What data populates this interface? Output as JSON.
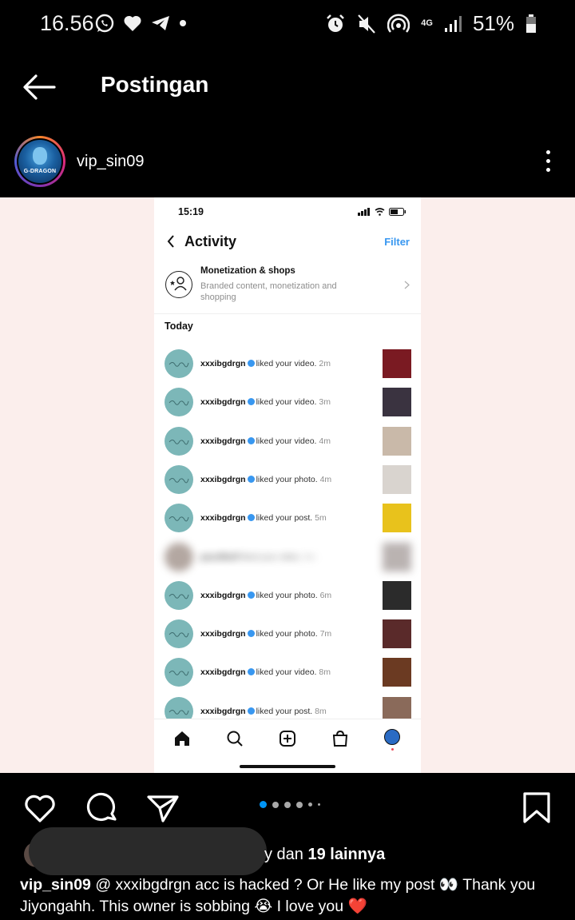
{
  "status_bar": {
    "time": "16.56",
    "battery": "51%",
    "network": "4G"
  },
  "header": {
    "title": "Postingan"
  },
  "post": {
    "username": "vip_sin09",
    "avatar_text": "G-DRAGON"
  },
  "screenshot": {
    "time": "15:19",
    "title": "Activity",
    "filter": "Filter",
    "monetization": {
      "title": "Monetization & shops",
      "subtitle": "Branded content, monetization and shopping"
    },
    "section": "Today",
    "activity": [
      {
        "user": "xxxibgdrgn",
        "action": "liked your video.",
        "time": "2m",
        "thumb": "#7a1a22"
      },
      {
        "user": "xxxibgdrgn",
        "action": "liked your video.",
        "time": "3m",
        "thumb": "#3a3340"
      },
      {
        "user": "xxxibgdrgn",
        "action": "liked your video.",
        "time": "4m",
        "thumb": "#c9b9a9"
      },
      {
        "user": "xxxibgdrgn",
        "action": "liked your photo.",
        "time": "4m",
        "thumb": "#d9d4cf"
      },
      {
        "user": "xxxibgdrgn",
        "action": "liked your post.",
        "time": "5m",
        "thumb": "#e8c21c"
      },
      {
        "user": "pacellkelf",
        "action": "liked your video.",
        "time": "8m",
        "thumb": "#a39a98",
        "blurred": true
      },
      {
        "user": "xxxibgdrgn",
        "action": "liked your photo.",
        "time": "6m",
        "thumb": "#2b2b2b"
      },
      {
        "user": "xxxibgdrgn",
        "action": "liked your photo.",
        "time": "7m",
        "thumb": "#5a2a2a"
      },
      {
        "user": "xxxibgdrgn",
        "action": "liked your video.",
        "time": "8m",
        "thumb": "#6b3a22"
      },
      {
        "user": "xxxibgdrgn",
        "action": "liked your post.",
        "time": "8m",
        "thumb": "#8a6a5a"
      }
    ]
  },
  "carousel": {
    "count": 6,
    "active": 0
  },
  "likes": {
    "prefix": "y dan ",
    "count": "19 lainnya"
  },
  "caption": {
    "user": "vip_sin09",
    "text": "@ xxxibgdrgn acc is hacked ? Or He like my post 👀 Thank you Jiyongahh. This owner is sobbing 😭 I love you ❤️"
  },
  "colors": {
    "accent_blue": "#0095f6",
    "filter_blue": "#3897f0",
    "post_bg": "#fbeeec",
    "avatar_teal": "#7cb7b8"
  },
  "icons": [
    "whatsapp-icon",
    "heart-icon",
    "telegram-icon",
    "alarm-icon",
    "mute-icon",
    "hotspot-icon",
    "signal-icon",
    "battery-icon",
    "back-arrow-icon",
    "more-icon",
    "like-icon",
    "comment-icon",
    "share-icon",
    "bookmark-icon"
  ]
}
